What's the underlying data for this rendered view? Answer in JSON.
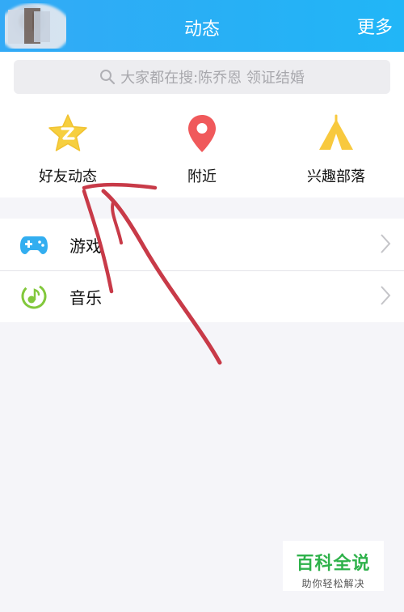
{
  "header": {
    "title": "动态",
    "more_label": "更多"
  },
  "search": {
    "text": "大家都在搜:陈乔恩 领证结婚"
  },
  "quick_actions": [
    {
      "label": "好友动态",
      "icon": "qzone-star-icon"
    },
    {
      "label": "附近",
      "icon": "location-pin-icon"
    },
    {
      "label": "兴趣部落",
      "icon": "tent-icon"
    }
  ],
  "list": [
    {
      "label": "游戏",
      "icon": "gamepad-icon"
    },
    {
      "label": "音乐",
      "icon": "music-note-icon"
    }
  ],
  "watermark": {
    "title": "百科全说",
    "subtitle": "助你轻松解决"
  },
  "colors": {
    "header": "#2aaef6",
    "star": "#f6cf3f",
    "pin": "#f0595b",
    "tent": "#f8c93e",
    "game": "#33aef0",
    "music": "#82c83c",
    "annotation": "#c83a48"
  }
}
